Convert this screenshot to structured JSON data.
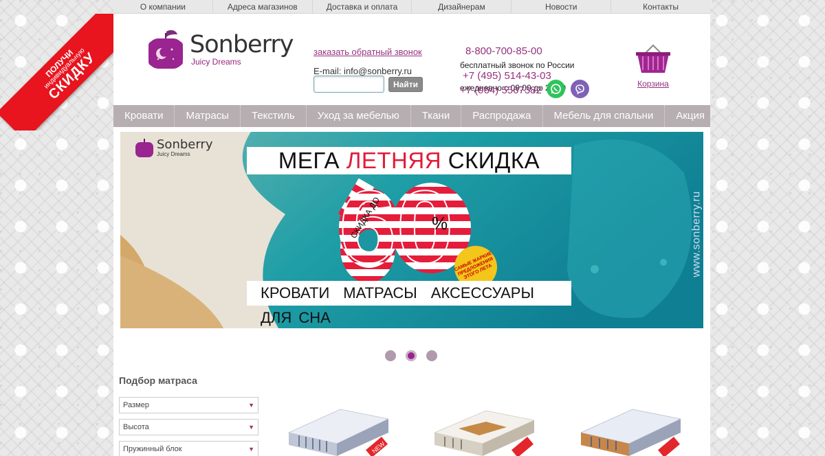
{
  "promo": {
    "line1": "ПОЛУЧИ",
    "line2": "индивидуальную",
    "line3": "СКИДКУ"
  },
  "topnav": [
    "О компании",
    "Адреса магазинов",
    "Доставка и оплата",
    "Дизайнерам",
    "Новости",
    "Контакты"
  ],
  "logo": {
    "name": "Sonberry",
    "tagline": "Juicy Dreams"
  },
  "header": {
    "callback": "заказать обратный звонок",
    "email": "E-mail: info@sonberry.ru",
    "search_button": "Найти",
    "search_placeholder": "",
    "phone_free": "8-800-700-85-00",
    "phone_free_note": "бесплатный звонок по России",
    "phone_moscow": "+7 (495) 514-43-03",
    "hours": "ежедневно с 09:00 до 21:00",
    "phone_mobile": "+7 (964) 5567382",
    "cart_label": "Корзина"
  },
  "mainnav": [
    "Кровати",
    "Матрасы",
    "Текстиль",
    "Уход за мебелью",
    "Ткани",
    "Распродажа",
    "Мебель для спальни",
    "Акция"
  ],
  "banner": {
    "logo_name": "Sonberry",
    "logo_tag": "Juicy Dreams",
    "headline_a": "МЕГА ",
    "headline_b": "ЛЕТНЯЯ",
    "headline_c": " СКИДКА",
    "skidka_do": "СКИДКА ДО",
    "big_number": "60",
    "percent": "%",
    "badge": "САМЫЕ ЖАРКИЕ ПРЕДЛОЖЕНИЯ ЭТОГО ЛЕТА",
    "cats": [
      "КРОВАТИ",
      "МАТРАСЫ",
      "АКСЕССУАРЫ ДЛЯ СНА"
    ],
    "url": "www.sonberry.ru"
  },
  "slider": {
    "count": 3,
    "active": 2
  },
  "filter": {
    "title": "Подбор матраса",
    "selects": [
      "Размер",
      "Высота",
      "Пружинный блок"
    ]
  },
  "products_badge": "NEW",
  "colors": {
    "brand": "#95327e",
    "nav": "#b6aeb1",
    "promo": "#e8141e"
  }
}
